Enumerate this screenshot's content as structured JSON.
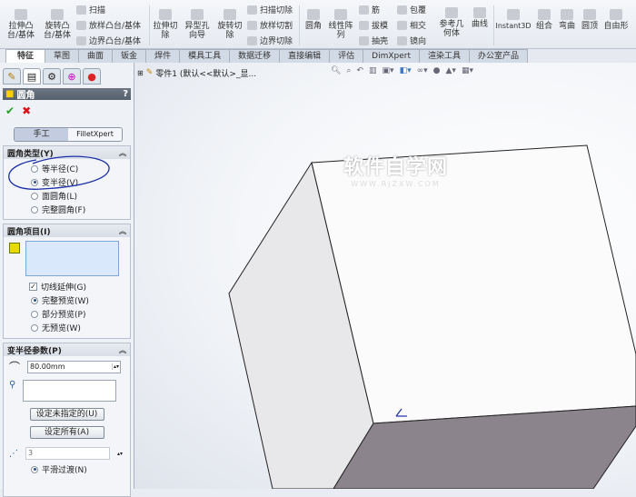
{
  "toolbar": {
    "big": [
      {
        "label": "拉伸凸\n台/基体"
      },
      {
        "label": "旋转凸\n台/基体"
      },
      {
        "label": "拉伸切\n除"
      },
      {
        "label": "异型孔\n向导"
      },
      {
        "label": "旋转切\n除"
      },
      {
        "label": "圆角"
      },
      {
        "label": "线性阵\n列"
      },
      {
        "label": "参考几\n何体"
      },
      {
        "label": "曲线"
      },
      {
        "label": "Instant3D"
      },
      {
        "label": "组合"
      },
      {
        "label": "弯曲"
      },
      {
        "label": "圆顶"
      },
      {
        "label": "自由形"
      }
    ],
    "small": [
      "扫描",
      "放样凸台/基体",
      "边界凸台/基体",
      "扫描切除",
      "放样切割",
      "边界切除",
      "筋",
      "拔模",
      "抽壳",
      "包覆",
      "相交",
      "镜向"
    ]
  },
  "tabs": [
    "特征",
    "草图",
    "曲面",
    "钣金",
    "焊件",
    "模具工具",
    "数据迁移",
    "直接编辑",
    "评估",
    "DimXpert",
    "渲染工具",
    "办公室产品"
  ],
  "panel": {
    "title": "圆角",
    "help": "?",
    "mode_manual": "手工",
    "mode_expert": "FilletXpert",
    "type_group": {
      "title": "圆角类型(Y)",
      "options": [
        "等半径(C)",
        "变半径(V)",
        "面圆角(L)",
        "完整圆角(F)"
      ],
      "selected": 1
    },
    "items_group": {
      "title": "圆角项目(I)",
      "tangent": "切线延伸(G)",
      "preview": [
        "完整预览(W)",
        "部分预览(P)",
        "无预览(W)"
      ],
      "preview_selected": 0
    },
    "param_group": {
      "title": "变半径参数(P)",
      "radius": "80.00mm",
      "set_unassigned": "设定未指定的(U)",
      "set_all": "设定所有(A)",
      "instances": "3",
      "smooth": "平滑过渡(N)"
    }
  },
  "view": {
    "tree_label": "零件1 (默认<<默认>_显...",
    "watermark": "软件自学网",
    "watermark_url": "WWW.RJZXW.COM"
  },
  "colors": {
    "annotation": "#1c2fa8",
    "dark_face": "#8b848c"
  }
}
